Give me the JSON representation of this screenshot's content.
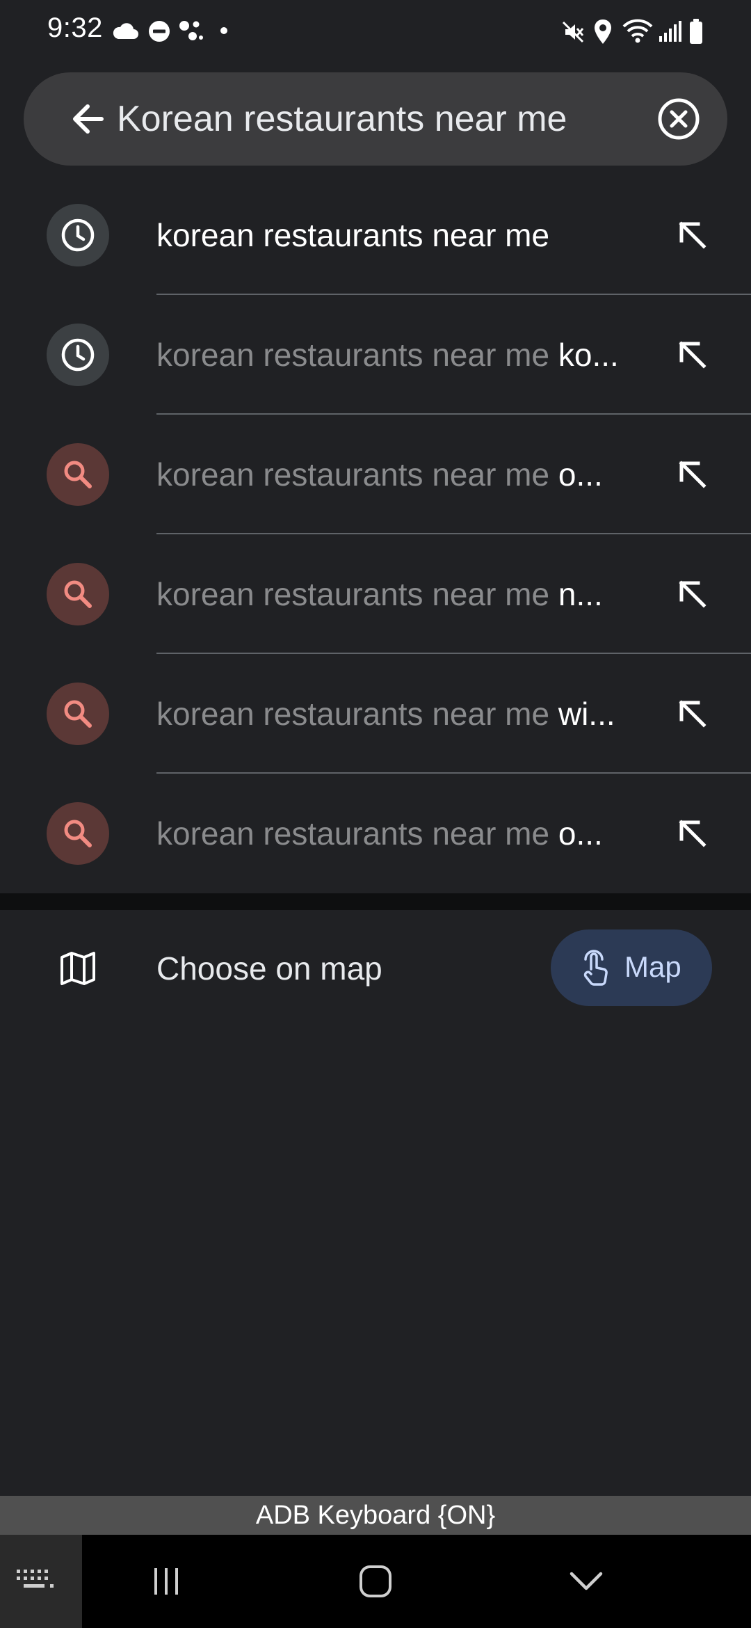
{
  "status_bar": {
    "time": "9:32",
    "left_icons": [
      "cloud-icon",
      "do-not-disturb-icon",
      "assistant-dots-icon",
      "notification-dot-icon"
    ],
    "right_icons": [
      "mute-icon",
      "location-icon",
      "wifi-icon",
      "signal-icon",
      "battery-icon"
    ]
  },
  "search": {
    "query": "Korean restaurants near me",
    "back_icon": "arrow-left-icon",
    "clear_icon": "clear-circle-icon"
  },
  "suggestions": [
    {
      "type": "history",
      "icon": "clock-icon",
      "query_part": "korean restaurants near me",
      "rest": "",
      "action_icon": "arrow-up-left-icon"
    },
    {
      "type": "history",
      "icon": "clock-icon",
      "query_part": "korean restaurants near me",
      "rest": " ko...",
      "action_icon": "arrow-up-left-icon"
    },
    {
      "type": "search",
      "icon": "search-icon",
      "query_part": "korean restaurants near me",
      "rest": " o...",
      "action_icon": "arrow-up-left-icon"
    },
    {
      "type": "search",
      "icon": "search-icon",
      "query_part": "korean restaurants near me",
      "rest": " n...",
      "action_icon": "arrow-up-left-icon"
    },
    {
      "type": "search",
      "icon": "search-icon",
      "query_part": "korean restaurants near me",
      "rest": " wi...",
      "action_icon": "arrow-up-left-icon"
    },
    {
      "type": "search",
      "icon": "search-icon",
      "query_part": "korean restaurants near me",
      "rest": " o...",
      "action_icon": "arrow-up-left-icon"
    }
  ],
  "choose_on_map": {
    "label": "Choose on map",
    "icon": "map-icon",
    "button_label": "Map",
    "button_icon": "touch-hand-icon"
  },
  "keyboard_status": "ADB Keyboard {ON}",
  "nav_bar": {
    "icons": [
      "keyboard-icon",
      "recents-icon",
      "home-icon",
      "hide-keyboard-icon"
    ]
  },
  "colors": {
    "background": "#202124",
    "search_bar": "#3c3c3e",
    "history_icon_bg": "#3c4043",
    "search_icon_bg": "#5b3836",
    "search_icon_fg": "#f28b82",
    "map_button_bg": "#2c3a55",
    "map_button_fg": "#c9d9fb"
  }
}
